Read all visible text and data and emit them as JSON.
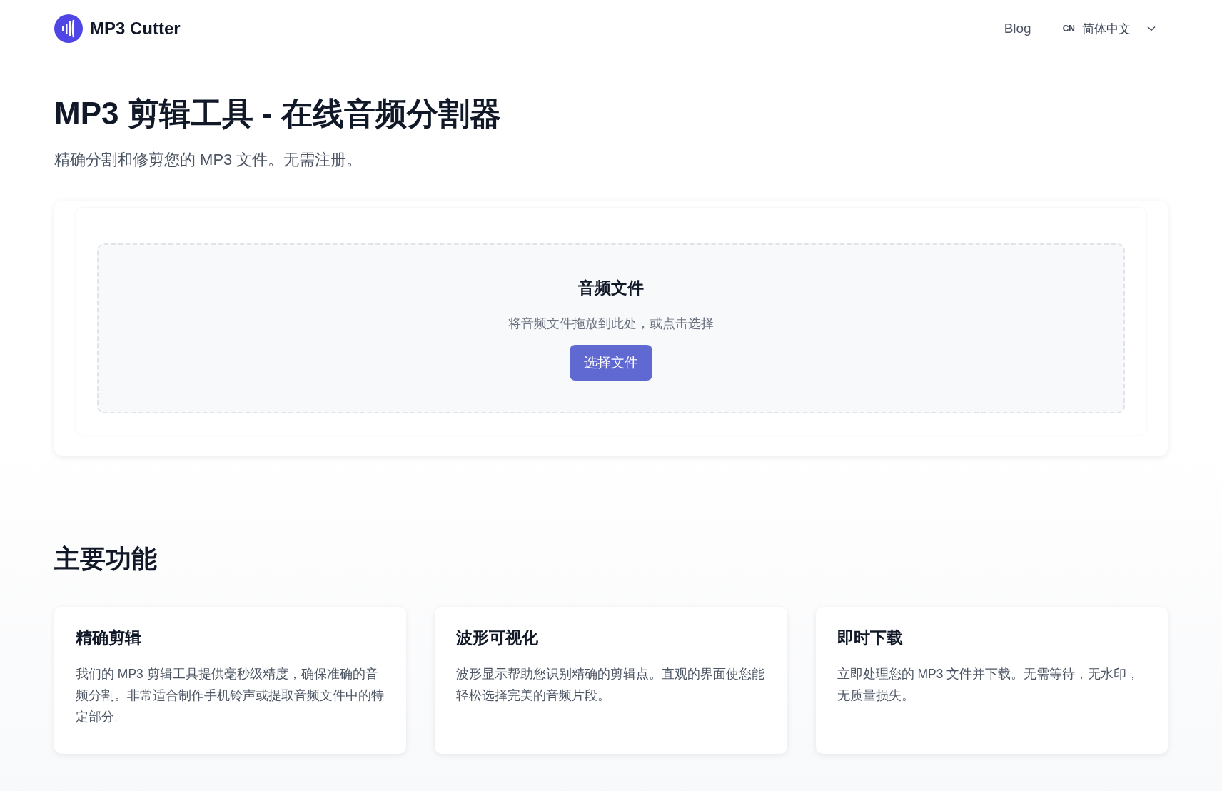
{
  "header": {
    "logo_text": "MP3 Cutter",
    "nav": [
      {
        "label": "Blog"
      }
    ],
    "language": {
      "code": "CN",
      "label": "简体中文"
    }
  },
  "hero": {
    "title": "MP3 剪辑工具 - 在线音频分割器",
    "subtitle": "精确分割和修剪您的 MP3 文件。无需注册。"
  },
  "upload": {
    "title": "音频文件",
    "hint": "将音频文件拖放到此处，或点击选择",
    "button": "选择文件"
  },
  "features": {
    "heading": "主要功能",
    "items": [
      {
        "title": "精确剪辑",
        "text": "我们的 MP3 剪辑工具提供毫秒级精度，确保准确的音频分割。非常适合制作手机铃声或提取音频文件中的特定部分。"
      },
      {
        "title": "波形可视化",
        "text": "波形显示帮助您识别精确的剪辑点。直观的界面使您能轻松选择完美的音频片段。"
      },
      {
        "title": "即时下载",
        "text": "立即处理您的 MP3 文件并下载。无需等待，无水印，无质量损失。"
      }
    ]
  }
}
